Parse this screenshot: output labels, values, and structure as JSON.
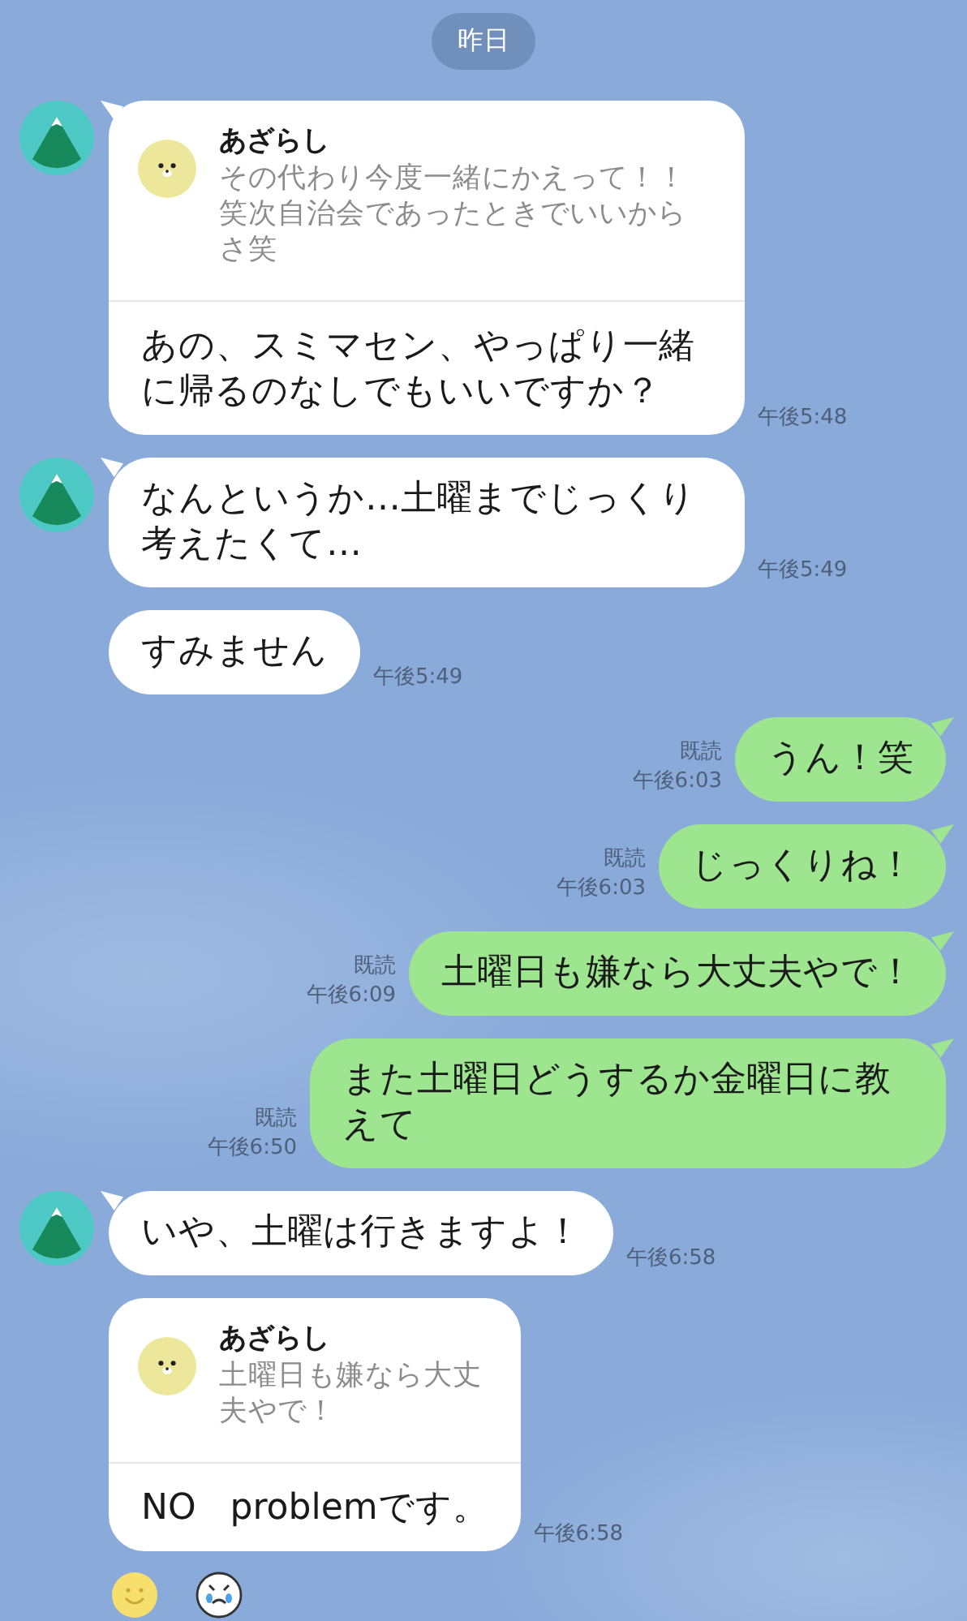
{
  "date_label": "昨日",
  "messages": [
    {
      "kind": "incoming",
      "show_avatar": true,
      "quote": {
        "name": "あざらし",
        "text": "その代わり今度一緒にかえって！！笑次自治会であったときでいいからさ笑"
      },
      "text": "あの、スミマセン、やっぱり一緒に帰るのなしでもいいですか？",
      "time": "午後5:48"
    },
    {
      "kind": "incoming",
      "show_avatar": true,
      "text": "なんというか…土曜までじっくり考えたくて…",
      "time": "午後5:49"
    },
    {
      "kind": "incoming",
      "show_avatar": false,
      "text": "すみません",
      "time": "午後5:49"
    },
    {
      "kind": "outgoing",
      "read": "既読",
      "text": "うん！笑",
      "time": "午後6:03"
    },
    {
      "kind": "outgoing",
      "read": "既読",
      "text": "じっくりね！",
      "time": "午後6:03"
    },
    {
      "kind": "outgoing",
      "read": "既読",
      "text": "土曜日も嫌なら大丈夫やで！",
      "time": "午後6:09"
    },
    {
      "kind": "outgoing",
      "read": "既読",
      "text": "また土曜日どうするか金曜日に教えて",
      "time": "午後6:50"
    },
    {
      "kind": "incoming",
      "show_avatar": true,
      "text": "いや、土曜は行きますよ！",
      "time": "午後6:58"
    },
    {
      "kind": "incoming",
      "show_avatar": false,
      "quote": {
        "name": "あざらし",
        "text": "土曜日も嫌なら大丈夫やで！"
      },
      "text": "NO   problemです。",
      "time": "午後6:58"
    }
  ]
}
